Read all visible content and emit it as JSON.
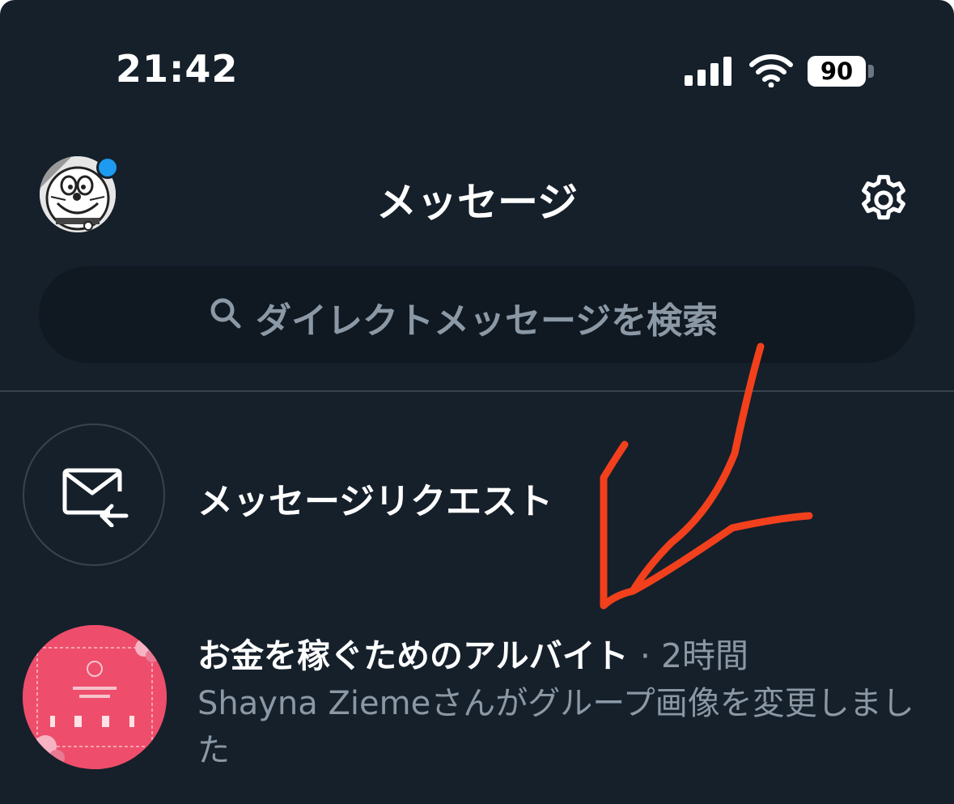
{
  "status_bar": {
    "time": "21:42",
    "battery": "90"
  },
  "header": {
    "title": "メッセージ"
  },
  "search": {
    "placeholder": "ダイレクトメッセージを検索"
  },
  "message_requests": {
    "label": "メッセージリクエスト"
  },
  "conversations": [
    {
      "name": "お金を稼ぐためのアルバイト",
      "separator": "·",
      "time": "2時間",
      "preview": "Shayna Ziemeさんがグループ画像を変更しました"
    }
  ],
  "colors": {
    "background": "#15202b",
    "search_background": "#101821",
    "secondary_text": "#8b98a5",
    "accent": "#1d9bf0",
    "annotation": "#f2401c"
  },
  "icons": {
    "settings": "gear-icon",
    "search": "search-icon",
    "message_request": "envelope-arrow-icon"
  }
}
